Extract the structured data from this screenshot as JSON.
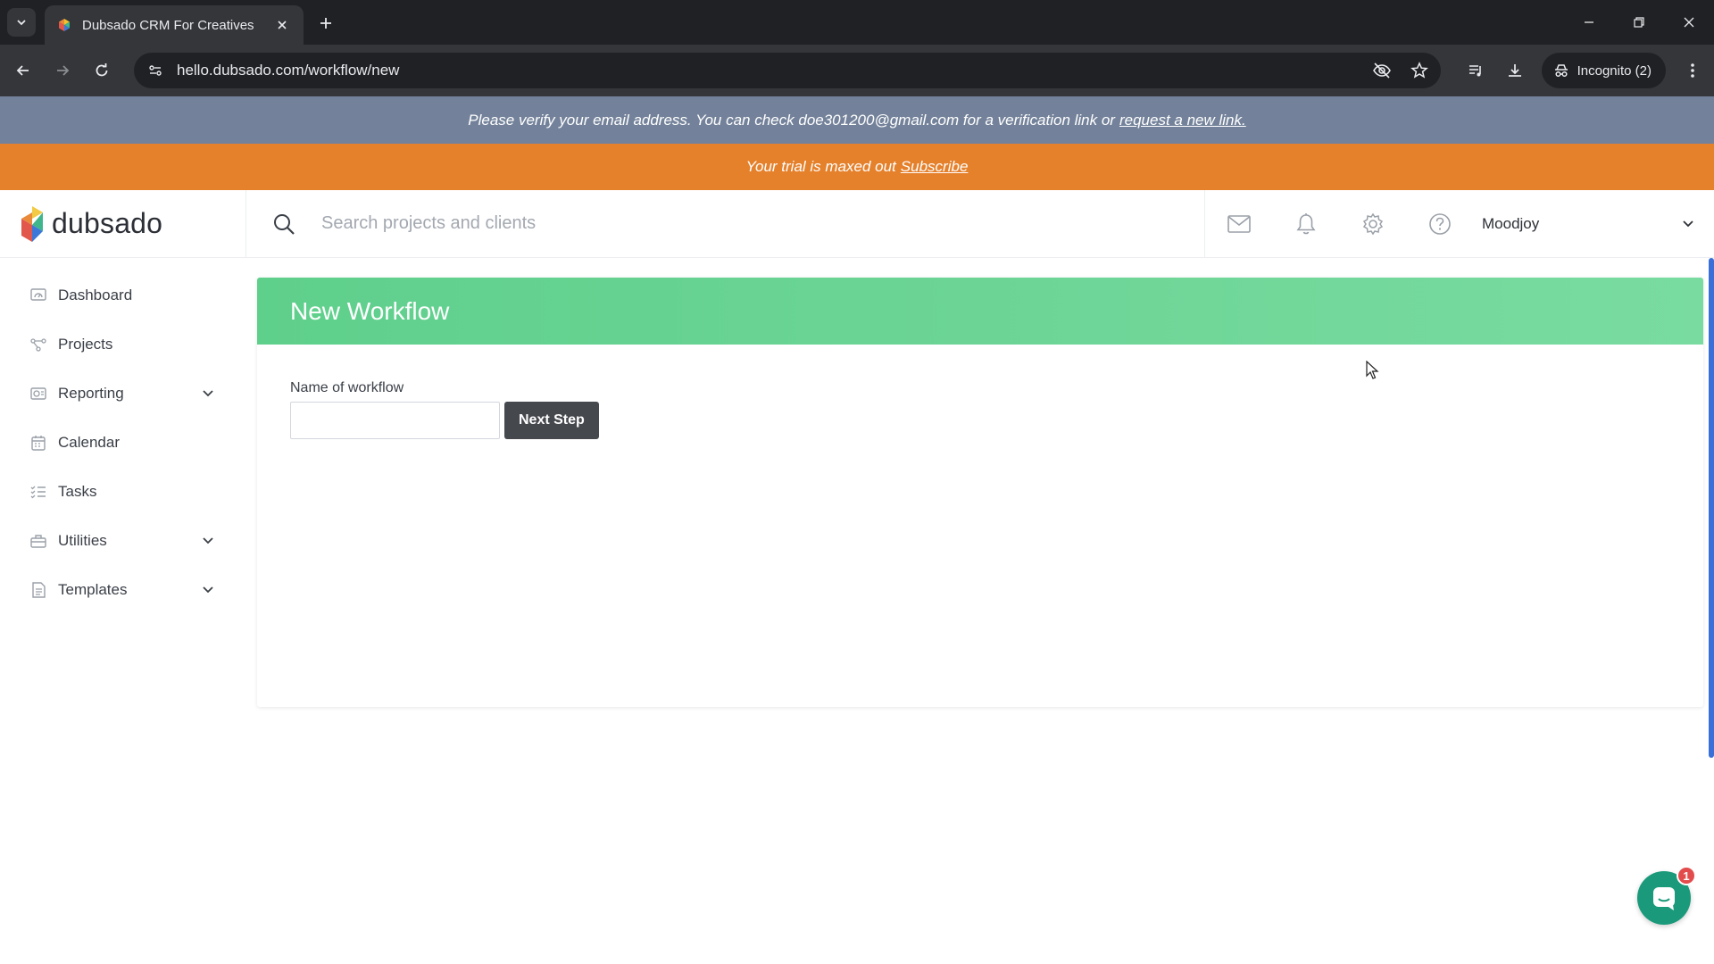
{
  "browser": {
    "tab_title": "Dubsado CRM For Creatives",
    "url": "hello.dubsado.com/workflow/new",
    "incognito_label": "Incognito (2)"
  },
  "banners": {
    "verify_text": "Please verify your email address. You can check doe301200@gmail.com for a verification link or",
    "verify_link": "request a new link.",
    "trial_text": "Your trial is maxed out",
    "trial_link": "Subscribe"
  },
  "header": {
    "logo": "dubsado",
    "search_placeholder": "Search projects and clients",
    "user_name": "Moodjoy",
    "icons": [
      "mail-icon",
      "bell-icon",
      "gear-icon",
      "help-icon"
    ]
  },
  "sidebar": {
    "items": [
      {
        "label": "Dashboard",
        "icon": "dashboard-icon",
        "has_chevron": false
      },
      {
        "label": "Projects",
        "icon": "projects-icon",
        "has_chevron": false
      },
      {
        "label": "Reporting",
        "icon": "reporting-icon",
        "has_chevron": true
      },
      {
        "label": "Calendar",
        "icon": "calendar-icon",
        "has_chevron": false
      },
      {
        "label": "Tasks",
        "icon": "tasks-icon",
        "has_chevron": false
      },
      {
        "label": "Utilities",
        "icon": "utilities-icon",
        "has_chevron": true
      },
      {
        "label": "Templates",
        "icon": "templates-icon",
        "has_chevron": true
      }
    ]
  },
  "main": {
    "title": "New Workflow",
    "field_label": "Name of workflow",
    "field_value": "",
    "next_button": "Next Step"
  },
  "chat": {
    "badge_count": "1"
  },
  "colors": {
    "verify_banner": "#73829a",
    "trial_banner": "#e5802b",
    "header_green": "#5fcf8c",
    "button_dark": "#45484d"
  }
}
